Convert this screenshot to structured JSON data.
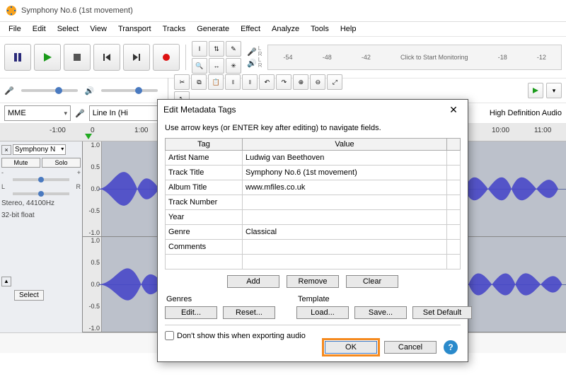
{
  "window": {
    "title": "Symphony No.6 (1st movement)"
  },
  "menu": [
    "File",
    "Edit",
    "Select",
    "View",
    "Transport",
    "Tracks",
    "Generate",
    "Effect",
    "Analyze",
    "Tools",
    "Help"
  ],
  "meter": {
    "ticks": [
      "-54",
      "-48",
      "-42"
    ],
    "hint": "Click to Start Monitoring",
    "ticks2": [
      "-18",
      "-12"
    ]
  },
  "device": {
    "host": "MME",
    "input": "Line In (Hi",
    "output": "High Definition Audio"
  },
  "timeline": {
    "ticks": [
      "-1:00",
      "0",
      "1:00",
      "10:00",
      "11:00"
    ]
  },
  "track": {
    "name": "Symphony N",
    "mute": "Mute",
    "solo": "Solo",
    "gain": {
      "minus": "-",
      "plus": "+"
    },
    "pan": {
      "l": "L",
      "r": "R"
    },
    "info1": "Stereo, 44100Hz",
    "info2": "32-bit float",
    "vscale": [
      "1.0",
      "0.5",
      "0.0",
      "-0.5",
      "-1.0"
    ],
    "select": "Select"
  },
  "dialog": {
    "title": "Edit Metadata Tags",
    "hint": "Use arrow keys (or ENTER key after editing) to navigate fields.",
    "headers": {
      "tag": "Tag",
      "value": "Value"
    },
    "rows": [
      {
        "tag": "Artist Name",
        "value": "Ludwig van Beethoven"
      },
      {
        "tag": "Track Title",
        "value": "Symphony No.6 (1st movement)"
      },
      {
        "tag": "Album Title",
        "value": "www.mfiles.co.uk"
      },
      {
        "tag": "Track Number",
        "value": ""
      },
      {
        "tag": "Year",
        "value": ""
      },
      {
        "tag": "Genre",
        "value": "Classical"
      },
      {
        "tag": "Comments",
        "value": ""
      }
    ],
    "buttons": {
      "add": "Add",
      "remove": "Remove",
      "clear": "Clear"
    },
    "genres": {
      "label": "Genres",
      "edit": "Edit...",
      "reset": "Reset..."
    },
    "template": {
      "label": "Template",
      "load": "Load...",
      "save": "Save...",
      "setdefault": "Set Default"
    },
    "dontshow": "Don't show this when exporting audio",
    "ok": "OK",
    "cancel": "Cancel"
  }
}
